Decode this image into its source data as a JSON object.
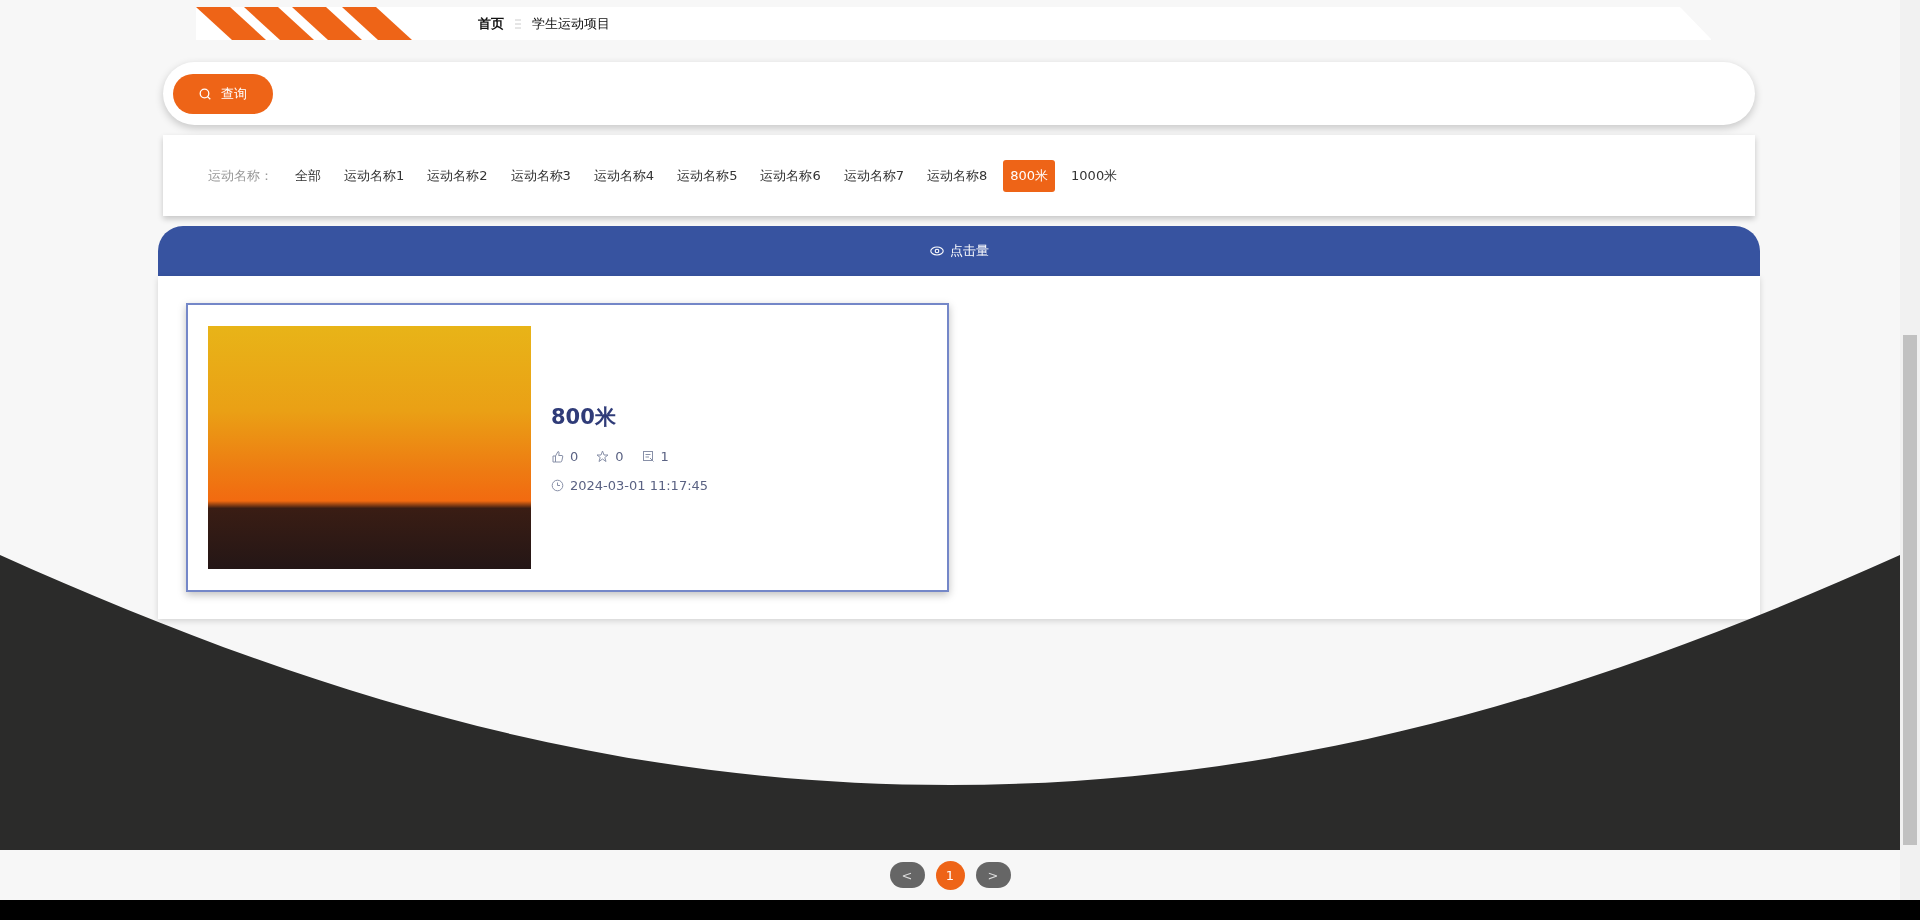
{
  "breadcrumb": {
    "home": "首页",
    "current": "学生运动项目"
  },
  "search_button": {
    "label": "查询"
  },
  "filter": {
    "label": "运动名称：",
    "options": [
      {
        "label": "全部",
        "selected": false
      },
      {
        "label": "运动名称1",
        "selected": false
      },
      {
        "label": "运动名称2",
        "selected": false
      },
      {
        "label": "运动名称3",
        "selected": false
      },
      {
        "label": "运动名称4",
        "selected": false
      },
      {
        "label": "运动名称5",
        "selected": false
      },
      {
        "label": "运动名称6",
        "selected": false
      },
      {
        "label": "运动名称7",
        "selected": false
      },
      {
        "label": "运动名称8",
        "selected": false
      },
      {
        "label": "800米",
        "selected": true
      },
      {
        "label": "1000米",
        "selected": false
      }
    ]
  },
  "sort_tab": {
    "label": "点击量"
  },
  "items": [
    {
      "title": "800米",
      "likes": "0",
      "favorites": "0",
      "comments": "1",
      "date": "2024-03-01 11:17:45"
    }
  ],
  "pagination": {
    "prev": "<",
    "pages": [
      {
        "label": "1",
        "selected": true
      }
    ],
    "next": ">"
  }
}
